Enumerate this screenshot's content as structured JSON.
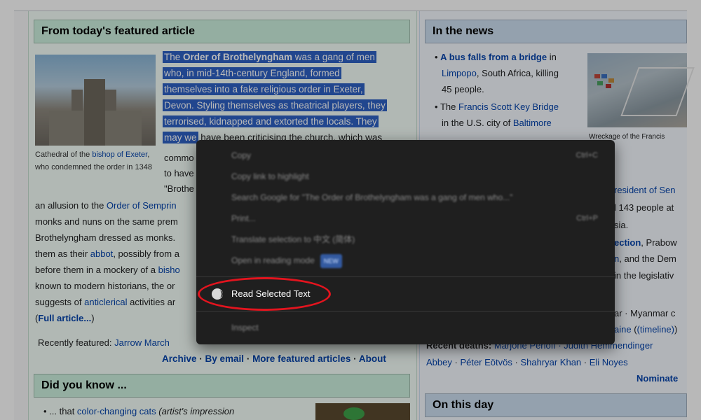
{
  "featured": {
    "heading": "From today's featured article",
    "selection_lines": [
      [
        "The ",
        "Order of Brothelyngham",
        " was a gang of men"
      ],
      [
        "who, in mid-14th-century England, formed",
        "",
        ""
      ],
      [
        "themselves into a fake religious order in Exeter,",
        "",
        ""
      ],
      [
        "Devon. Styling themselves as theatrical players, they",
        "",
        ""
      ],
      [
        "terrorised, kidnapped and extorted the locals. They",
        "",
        ""
      ],
      [
        "may we",
        "",
        ""
      ]
    ],
    "partial_after_sel": "have been criticising the church, which was",
    "side_lines": [
      "commo",
      "to have",
      "\"Brothe"
    ],
    "caption_pre": "Cathedral of the ",
    "caption_link1": "bishop of Exeter",
    "caption_post": ", who condemned the order in 1348",
    "body_lines": [
      {
        "pre": "an allusion to the ",
        "link": "Order of Semprin",
        "post": ""
      },
      {
        "pre": "monks and nuns on the same prem",
        "link": "",
        "post": ""
      },
      {
        "pre": "Brothelyngham dressed as monks.",
        "link": "",
        "post": ""
      },
      {
        "pre": "them as their ",
        "link": "abbot",
        "post": ", possibly from a"
      },
      {
        "pre": "before them in a mockery of a ",
        "link": "bisho",
        "post": ""
      },
      {
        "pre": "known to modern historians, the or",
        "link": "",
        "post": ""
      },
      {
        "pre": "suggests of ",
        "link": "anticlerical",
        "post": " activities ar"
      },
      {
        "pre": "(",
        "link": "Full article...",
        "post": ")"
      }
    ],
    "recently_label": "Recently featured: ",
    "recently_link": "Jarrow March",
    "footer_links": [
      "Archive",
      "By email",
      "More featured articles",
      "About"
    ]
  },
  "dyk": {
    "heading": "Did you know ...",
    "item_pre": "... that ",
    "item_link": "color-changing cats",
    "item_post": " (artist's impression"
  },
  "news": {
    "heading": "In the news",
    "item1_link": "A bus falls from a bridge",
    "item1_post": " in",
    "item1_line2_link": "Limpopo",
    "item1_line2_post": ", South Africa, killing",
    "item1_line3": "45 people.",
    "item2_pre": "The ",
    "item2_link": "Francis Scott Key Bridge",
    "item2_line2_pre": "in the U.S. city of ",
    "item2_line2_link": "Baltimore",
    "image_caption": "Wreckage of the Francis",
    "right_fragments": [
      {
        "pre": "",
        "link": "resident of Sen",
        "post": ""
      },
      {
        "pre": "l 143 people at",
        "link": "",
        "post": ""
      },
      {
        "pre": "sia.",
        "link": "",
        "post": ""
      },
      {
        "pre": "",
        "link": "ection",
        "post": ", Prabow"
      },
      {
        "pre": "",
        "link": "n",
        "post": ", and the Dem"
      },
      {
        "pre": "in the legislativ",
        "link": "",
        "post": ""
      }
    ],
    "ongoing_fragment": "ar · Myanmar c",
    "ongoing_fragment2_link": "aine",
    "ongoing_fragment2_rest": "(timeline)",
    "recent_deaths_label": "Recent deaths:",
    "recent_deaths_names": "Marjorie Perloff · Judith Hemmendinger",
    "deaths_line2": [
      "Abbey",
      "Péter Eötvös",
      "Shahryar Khan",
      "Eli Noyes"
    ],
    "nominate": "Nominate"
  },
  "on_this_day": {
    "heading": "On this day"
  },
  "context_menu": {
    "items": [
      {
        "label": "Copy",
        "shortcut": "Ctrl+C"
      },
      {
        "label": "Copy link to highlight",
        "shortcut": ""
      },
      {
        "label": "Search Google for \"The Order of Brothelyngham was a gang of men who...\"",
        "shortcut": ""
      },
      {
        "label": "Print...",
        "shortcut": "Ctrl+P"
      },
      {
        "label": "Translate selection to 中文 (简体)",
        "shortcut": ""
      },
      {
        "label": "Open in reading mode",
        "shortcut": "",
        "badge": "NEW"
      }
    ],
    "read_label": "Read Selected Text",
    "inspect_label": "Inspect"
  }
}
